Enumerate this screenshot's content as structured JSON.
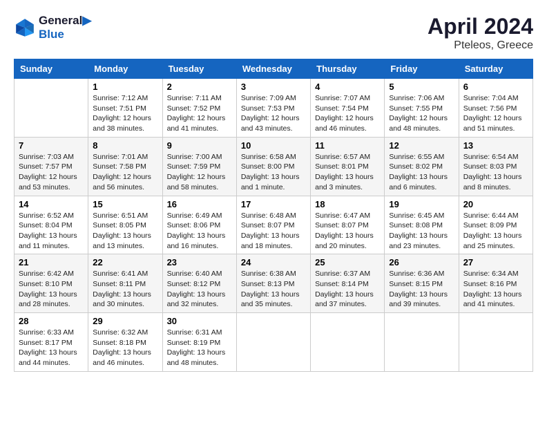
{
  "header": {
    "logo_line1": "General",
    "logo_line2": "Blue",
    "title": "April 2024",
    "subtitle": "Pteleos, Greece"
  },
  "columns": [
    "Sunday",
    "Monday",
    "Tuesday",
    "Wednesday",
    "Thursday",
    "Friday",
    "Saturday"
  ],
  "weeks": [
    [
      {
        "day": "",
        "empty": true
      },
      {
        "day": "1",
        "sunrise": "7:12 AM",
        "sunset": "7:51 PM",
        "daylight": "12 hours and 38 minutes."
      },
      {
        "day": "2",
        "sunrise": "7:11 AM",
        "sunset": "7:52 PM",
        "daylight": "12 hours and 41 minutes."
      },
      {
        "day": "3",
        "sunrise": "7:09 AM",
        "sunset": "7:53 PM",
        "daylight": "12 hours and 43 minutes."
      },
      {
        "day": "4",
        "sunrise": "7:07 AM",
        "sunset": "7:54 PM",
        "daylight": "12 hours and 46 minutes."
      },
      {
        "day": "5",
        "sunrise": "7:06 AM",
        "sunset": "7:55 PM",
        "daylight": "12 hours and 48 minutes."
      },
      {
        "day": "6",
        "sunrise": "7:04 AM",
        "sunset": "7:56 PM",
        "daylight": "12 hours and 51 minutes."
      }
    ],
    [
      {
        "day": "7",
        "sunrise": "7:03 AM",
        "sunset": "7:57 PM",
        "daylight": "12 hours and 53 minutes."
      },
      {
        "day": "8",
        "sunrise": "7:01 AM",
        "sunset": "7:58 PM",
        "daylight": "12 hours and 56 minutes."
      },
      {
        "day": "9",
        "sunrise": "7:00 AM",
        "sunset": "7:59 PM",
        "daylight": "12 hours and 58 minutes."
      },
      {
        "day": "10",
        "sunrise": "6:58 AM",
        "sunset": "8:00 PM",
        "daylight": "13 hours and 1 minute."
      },
      {
        "day": "11",
        "sunrise": "6:57 AM",
        "sunset": "8:01 PM",
        "daylight": "13 hours and 3 minutes."
      },
      {
        "day": "12",
        "sunrise": "6:55 AM",
        "sunset": "8:02 PM",
        "daylight": "13 hours and 6 minutes."
      },
      {
        "day": "13",
        "sunrise": "6:54 AM",
        "sunset": "8:03 PM",
        "daylight": "13 hours and 8 minutes."
      }
    ],
    [
      {
        "day": "14",
        "sunrise": "6:52 AM",
        "sunset": "8:04 PM",
        "daylight": "13 hours and 11 minutes."
      },
      {
        "day": "15",
        "sunrise": "6:51 AM",
        "sunset": "8:05 PM",
        "daylight": "13 hours and 13 minutes."
      },
      {
        "day": "16",
        "sunrise": "6:49 AM",
        "sunset": "8:06 PM",
        "daylight": "13 hours and 16 minutes."
      },
      {
        "day": "17",
        "sunrise": "6:48 AM",
        "sunset": "8:07 PM",
        "daylight": "13 hours and 18 minutes."
      },
      {
        "day": "18",
        "sunrise": "6:47 AM",
        "sunset": "8:07 PM",
        "daylight": "13 hours and 20 minutes."
      },
      {
        "day": "19",
        "sunrise": "6:45 AM",
        "sunset": "8:08 PM",
        "daylight": "13 hours and 23 minutes."
      },
      {
        "day": "20",
        "sunrise": "6:44 AM",
        "sunset": "8:09 PM",
        "daylight": "13 hours and 25 minutes."
      }
    ],
    [
      {
        "day": "21",
        "sunrise": "6:42 AM",
        "sunset": "8:10 PM",
        "daylight": "13 hours and 28 minutes."
      },
      {
        "day": "22",
        "sunrise": "6:41 AM",
        "sunset": "8:11 PM",
        "daylight": "13 hours and 30 minutes."
      },
      {
        "day": "23",
        "sunrise": "6:40 AM",
        "sunset": "8:12 PM",
        "daylight": "13 hours and 32 minutes."
      },
      {
        "day": "24",
        "sunrise": "6:38 AM",
        "sunset": "8:13 PM",
        "daylight": "13 hours and 35 minutes."
      },
      {
        "day": "25",
        "sunrise": "6:37 AM",
        "sunset": "8:14 PM",
        "daylight": "13 hours and 37 minutes."
      },
      {
        "day": "26",
        "sunrise": "6:36 AM",
        "sunset": "8:15 PM",
        "daylight": "13 hours and 39 minutes."
      },
      {
        "day": "27",
        "sunrise": "6:34 AM",
        "sunset": "8:16 PM",
        "daylight": "13 hours and 41 minutes."
      }
    ],
    [
      {
        "day": "28",
        "sunrise": "6:33 AM",
        "sunset": "8:17 PM",
        "daylight": "13 hours and 44 minutes."
      },
      {
        "day": "29",
        "sunrise": "6:32 AM",
        "sunset": "8:18 PM",
        "daylight": "13 hours and 46 minutes."
      },
      {
        "day": "30",
        "sunrise": "6:31 AM",
        "sunset": "8:19 PM",
        "daylight": "13 hours and 48 minutes."
      },
      {
        "day": "",
        "empty": true
      },
      {
        "day": "",
        "empty": true
      },
      {
        "day": "",
        "empty": true
      },
      {
        "day": "",
        "empty": true
      }
    ]
  ],
  "labels": {
    "sunrise": "Sunrise:",
    "sunset": "Sunset:",
    "daylight": "Daylight:"
  }
}
